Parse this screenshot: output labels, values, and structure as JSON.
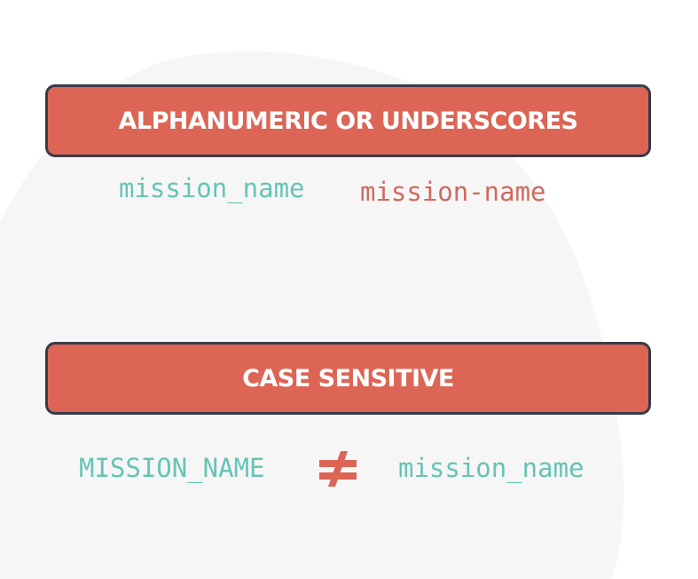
{
  "rules": [
    {
      "title": "ALPHANUMERIC OR UNDERSCORES",
      "examples": [
        {
          "text": "mission_name",
          "status": "valid"
        },
        {
          "text": "mission-name",
          "status": "invalid"
        }
      ]
    },
    {
      "title": "CASE SENSITIVE",
      "examples": [
        {
          "text": "MISSION_NAME"
        },
        {
          "text": "mission_name"
        }
      ],
      "relation_icon": "not-equal-icon"
    }
  ],
  "colors": {
    "banner": "#dc6556",
    "banner_border": "#3a3a48",
    "banner_text": "#ffffff",
    "valid_text": "#66c4b6",
    "invalid_text": "#cf6a5c",
    "background": "#ffffff",
    "background_shape": "#f6f6f7"
  }
}
